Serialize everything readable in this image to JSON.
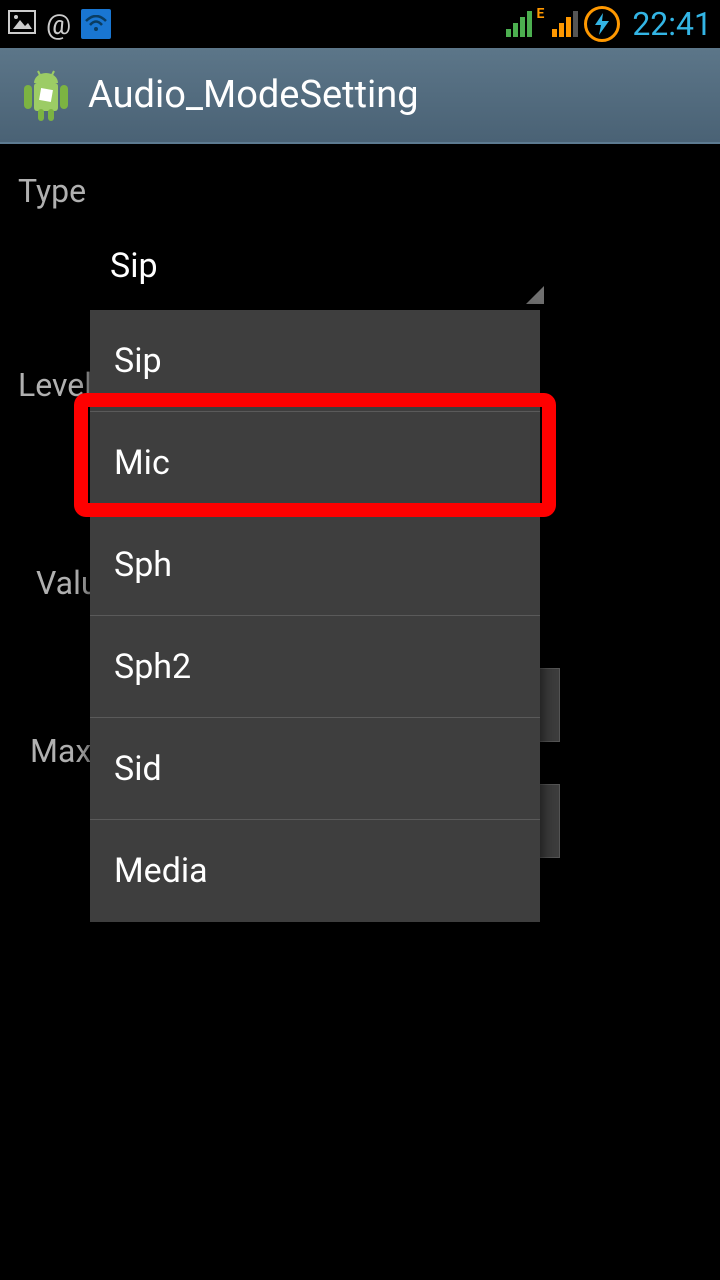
{
  "status": {
    "time": "22:41",
    "edge_label": "E"
  },
  "app": {
    "title": "Audio_ModeSetting"
  },
  "labels": {
    "type": "Type",
    "level": "Level",
    "value": "Value",
    "maxvol": "Max V"
  },
  "spinner": {
    "selected": "Sip"
  },
  "dropdown": {
    "items": [
      "Sip",
      "Mic",
      "Sph",
      "Sph2",
      "Sid",
      "Media"
    ],
    "highlighted_index": 1
  }
}
